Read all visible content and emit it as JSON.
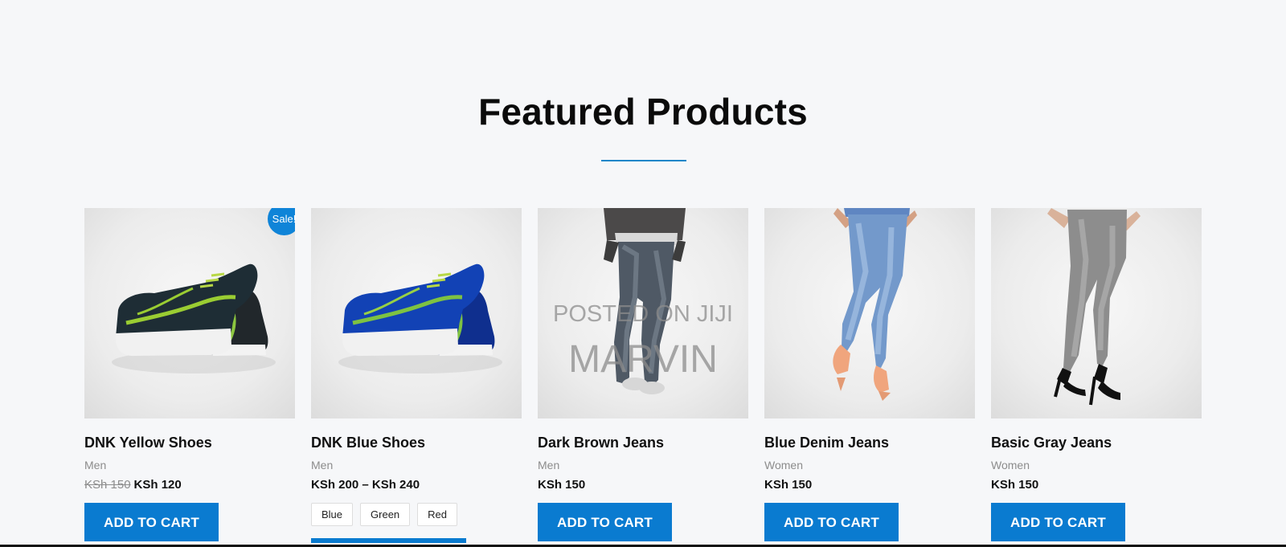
{
  "section": {
    "title": "Featured Products"
  },
  "products": [
    {
      "name": "DNK Yellow Shoes",
      "category": "Men",
      "old_price": "KSh 150",
      "price": "KSh 120",
      "badge": "Sale!",
      "button": "ADD TO CART",
      "image_icon": "shoe-image"
    },
    {
      "name": "DNK Blue Shoes",
      "category": "Men",
      "price": "KSh 200 – KSh 240",
      "swatches": [
        "Blue",
        "Green",
        "Red"
      ],
      "image_icon": "shoe-image"
    },
    {
      "name": "Dark Brown Jeans",
      "category": "Men",
      "price": "KSh 150",
      "button": "ADD TO CART",
      "image_icon": "jeans-image",
      "watermark": {
        "line1": "POSTED ON JIJI",
        "line2": "MARVIN"
      }
    },
    {
      "name": "Blue Denim Jeans",
      "category": "Women",
      "price": "KSh 150",
      "button": "ADD TO CART",
      "image_icon": "jeans-image"
    },
    {
      "name": "Basic Gray Jeans",
      "category": "Women",
      "price": "KSh 150",
      "button": "ADD TO CART",
      "image_icon": "jeans-image"
    }
  ],
  "colors": {
    "accent": "#0A7BD0",
    "sale_badge": "#0F84D8",
    "title_underline": "#1A86C8",
    "background": "#F6F7F9"
  }
}
